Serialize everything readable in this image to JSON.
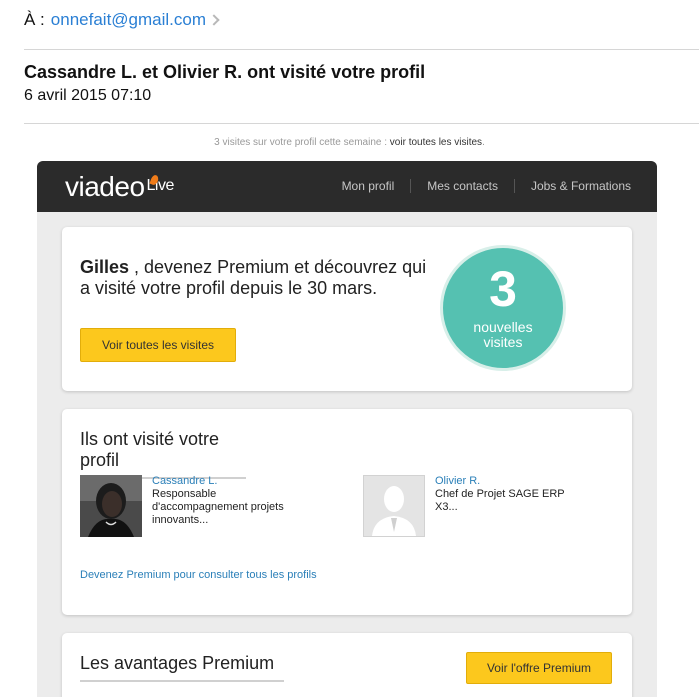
{
  "header": {
    "to_label": "À :",
    "to_address": "onnefait@gmail.com",
    "subject": "Cassandre L. et Olivier R. ont visité votre profil",
    "date": "6 avril 2015 07:10"
  },
  "visits_note": {
    "text": "3 visites sur votre profil cette semaine :",
    "link": "voir toutes les visites",
    "end": "."
  },
  "topbar": {
    "logo": "viadeo",
    "logo_suffix": "Live",
    "nav": [
      "Mon profil",
      "Mes contacts",
      "Jobs & Formations"
    ]
  },
  "promo": {
    "name": "Gilles",
    "text": " , devenez Premium et découvrez qui a visité votre profil depuis le 30 mars.",
    "button": "Voir toutes les visites",
    "count": "3",
    "count_label_1": "nouvelles",
    "count_label_2": "visites"
  },
  "visitors_card": {
    "title": "Ils ont visité votre profil",
    "visitors": [
      {
        "name": "Cassandre L.",
        "role": "Responsable d'accompagnement projets innovants..."
      },
      {
        "name": "Olivier R.",
        "role": "Chef de Projet SAGE ERP X3..."
      }
    ],
    "premium_link": "Devenez Premium pour consulter tous les profils"
  },
  "advantages_card": {
    "title": "Les avantages Premium",
    "button": "Voir l'offre Premium"
  },
  "colors": {
    "accent_link": "#2a7fb8",
    "button_yellow": "#fcc81d",
    "teal": "#55c1b1",
    "topbar": "#2b2b2b"
  }
}
